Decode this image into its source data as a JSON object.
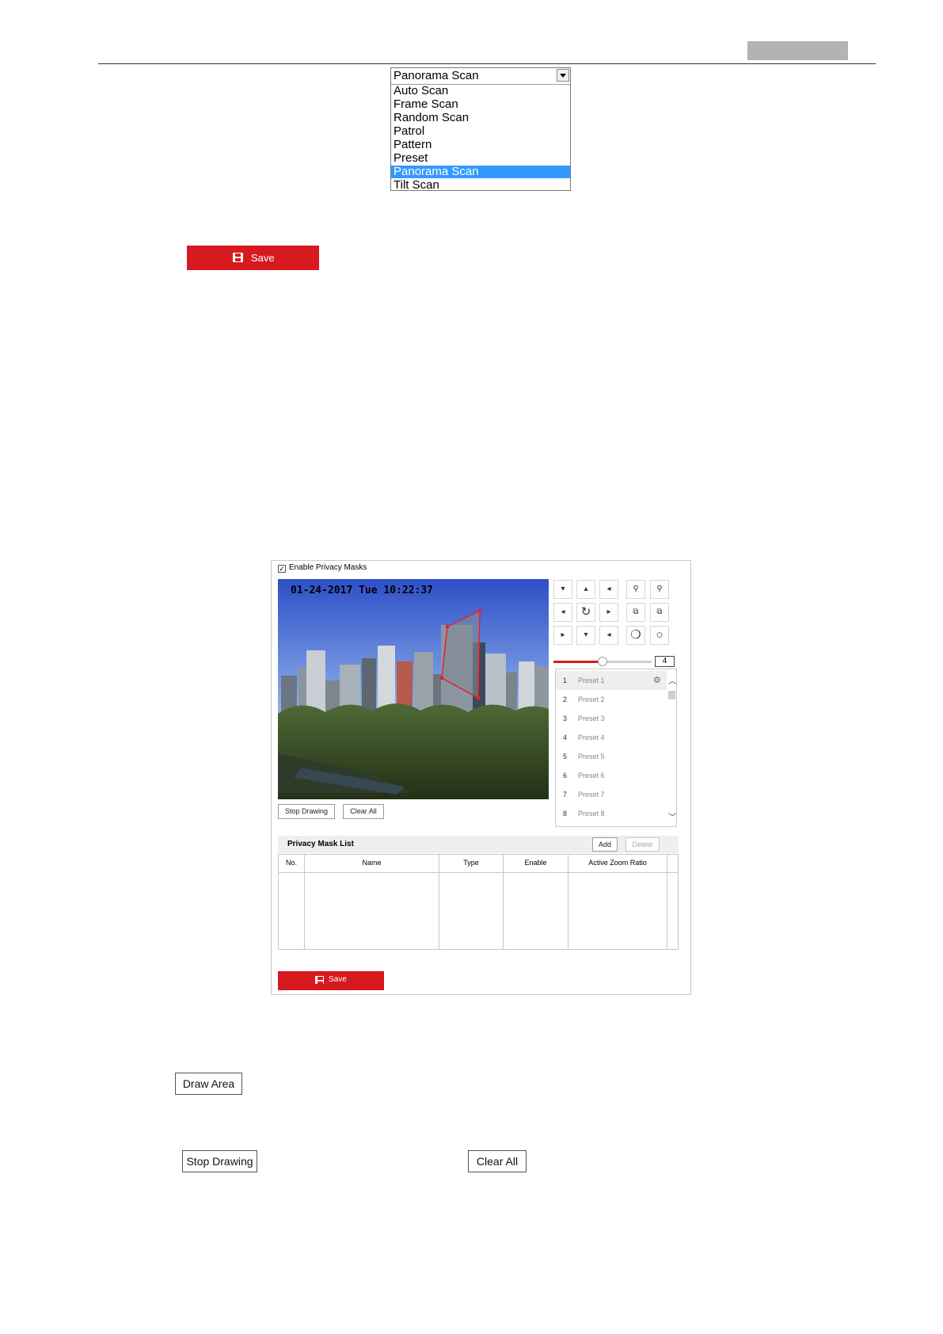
{
  "dropdown": {
    "selected": "Panorama Scan",
    "options": [
      "Auto Scan",
      "Frame Scan",
      "Random Scan",
      "Patrol",
      "Pattern",
      "Preset",
      "Panorama Scan",
      "Tilt Scan"
    ]
  },
  "save_label": "Save",
  "privacy": {
    "enable_label": "Enable Privacy Masks",
    "enable_checked": true,
    "timestamp": "01-24-2017 Tue 10:22:37",
    "speed_value": "4",
    "speed_level": 0.5,
    "presets": [
      {
        "num": "1",
        "name": "Preset 1"
      },
      {
        "num": "2",
        "name": "Preset 2"
      },
      {
        "num": "3",
        "name": "Preset 3"
      },
      {
        "num": "4",
        "name": "Preset 4"
      },
      {
        "num": "5",
        "name": "Preset 5"
      },
      {
        "num": "6",
        "name": "Preset 6"
      },
      {
        "num": "7",
        "name": "Preset 7"
      },
      {
        "num": "8",
        "name": "Preset 8"
      }
    ],
    "stop_drawing": "Stop Drawing",
    "clear_all": "Clear All",
    "list_title": "Privacy Mask List",
    "add": "Add",
    "delete": "Delete",
    "columns": [
      "No.",
      "Name",
      "Type",
      "Enable",
      "Active Zoom Ratio"
    ],
    "save": "Save"
  },
  "buttons": {
    "draw_area": "Draw Area",
    "stop_drawing": "Stop Drawing",
    "clear_all": "Clear All"
  },
  "colors": {
    "accent_red": "#d71920",
    "selection_blue": "#3399ff"
  }
}
